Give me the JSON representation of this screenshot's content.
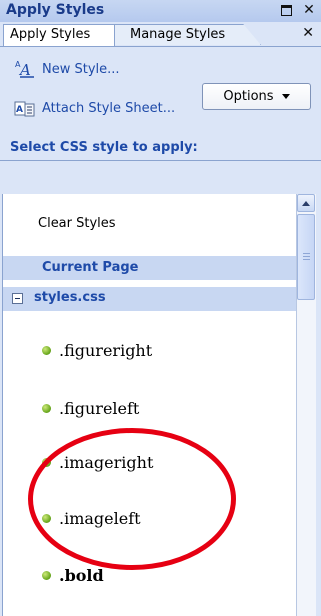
{
  "panel": {
    "title": "Apply Styles",
    "tabs": [
      {
        "label": "Apply Styles",
        "active": true
      },
      {
        "label": "Manage Styles",
        "active": false
      }
    ]
  },
  "actions": {
    "new_style": "New Style...",
    "attach": "Attach Style Sheet...",
    "options": "Options"
  },
  "section_label": "Select CSS style to apply:",
  "list": {
    "clear": "Clear Styles",
    "groups": [
      "Current Page",
      "styles.css"
    ],
    "items": [
      {
        "label": ".figureright",
        "bold": false
      },
      {
        "label": ".figureleft",
        "bold": false
      },
      {
        "label": ".imageright",
        "bold": false
      },
      {
        "label": ".imageleft",
        "bold": false
      },
      {
        "label": ".bold",
        "bold": true
      }
    ]
  },
  "colors": {
    "accent": "#1e4aa8",
    "annotation": "#e60012",
    "bullet": "#6aa81e"
  },
  "icons": [
    "maximize-icon",
    "close-icon",
    "new-style-icon",
    "attach-style-sheet-icon",
    "dropdown-caret-icon",
    "collapse-icon",
    "bullet-icon",
    "scroll-up-icon"
  ]
}
